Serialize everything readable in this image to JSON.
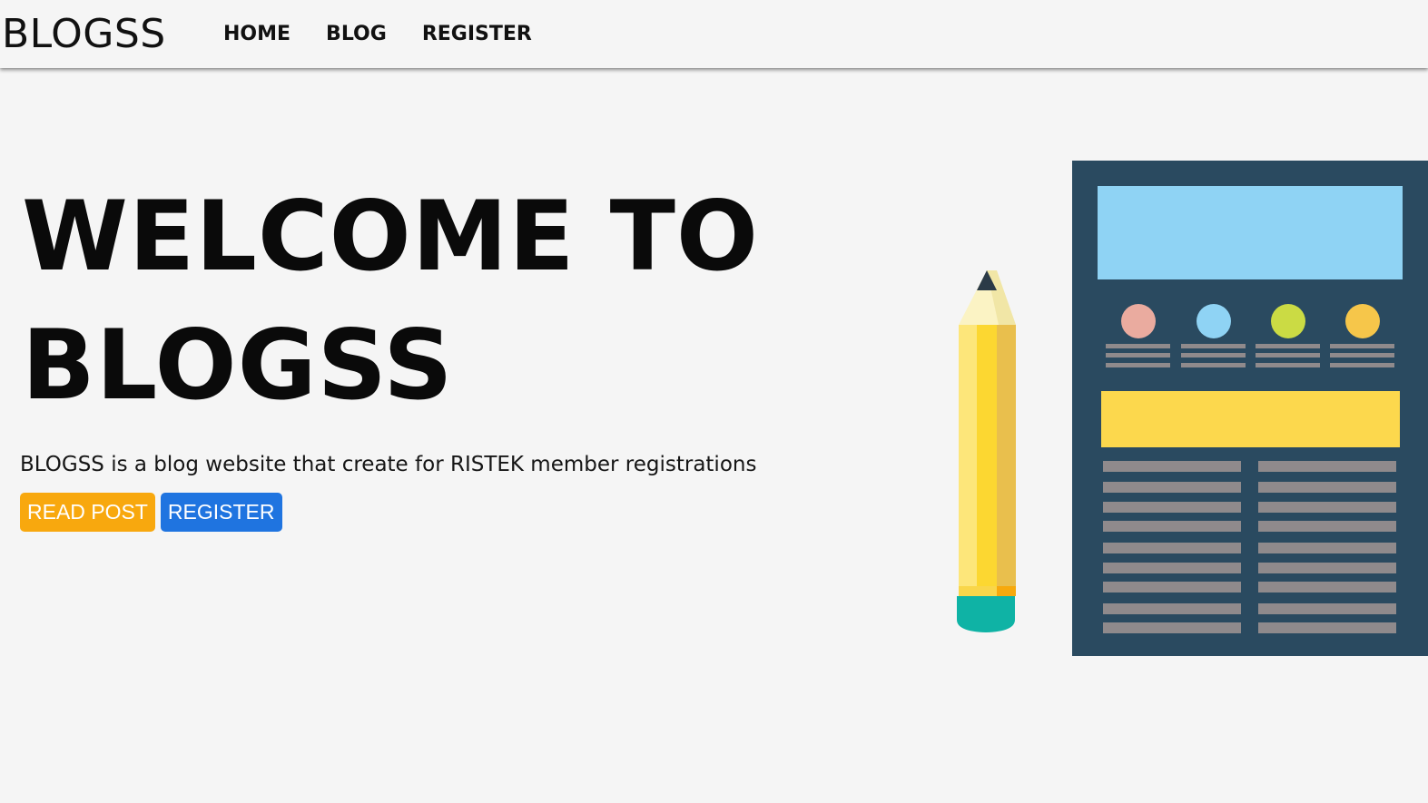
{
  "navbar": {
    "brand": "BLOGSS",
    "links": [
      {
        "label": "HOME"
      },
      {
        "label": "BLOG"
      },
      {
        "label": "REGISTER"
      }
    ]
  },
  "hero": {
    "title_line1": "WELCOME TO",
    "title_line2": "BLOGSS",
    "description": "BLOGSS is a blog website that create for RISTEK member registrations",
    "buttons": {
      "read_post": "READ POST",
      "register": "REGISTER"
    }
  },
  "colors": {
    "background": "#f5f5f5",
    "read_post_button": "#f8a80e",
    "register_button": "#1f74e0",
    "document_panel": "#2a4a60",
    "document_header": "#8fd3f4",
    "document_banner": "#fcd84d",
    "pencil_body": "#fcd731",
    "pencil_eraser": "#0fb3a5"
  },
  "icons": {
    "pencil": "pencil-icon",
    "document": "document-layout-icon"
  }
}
